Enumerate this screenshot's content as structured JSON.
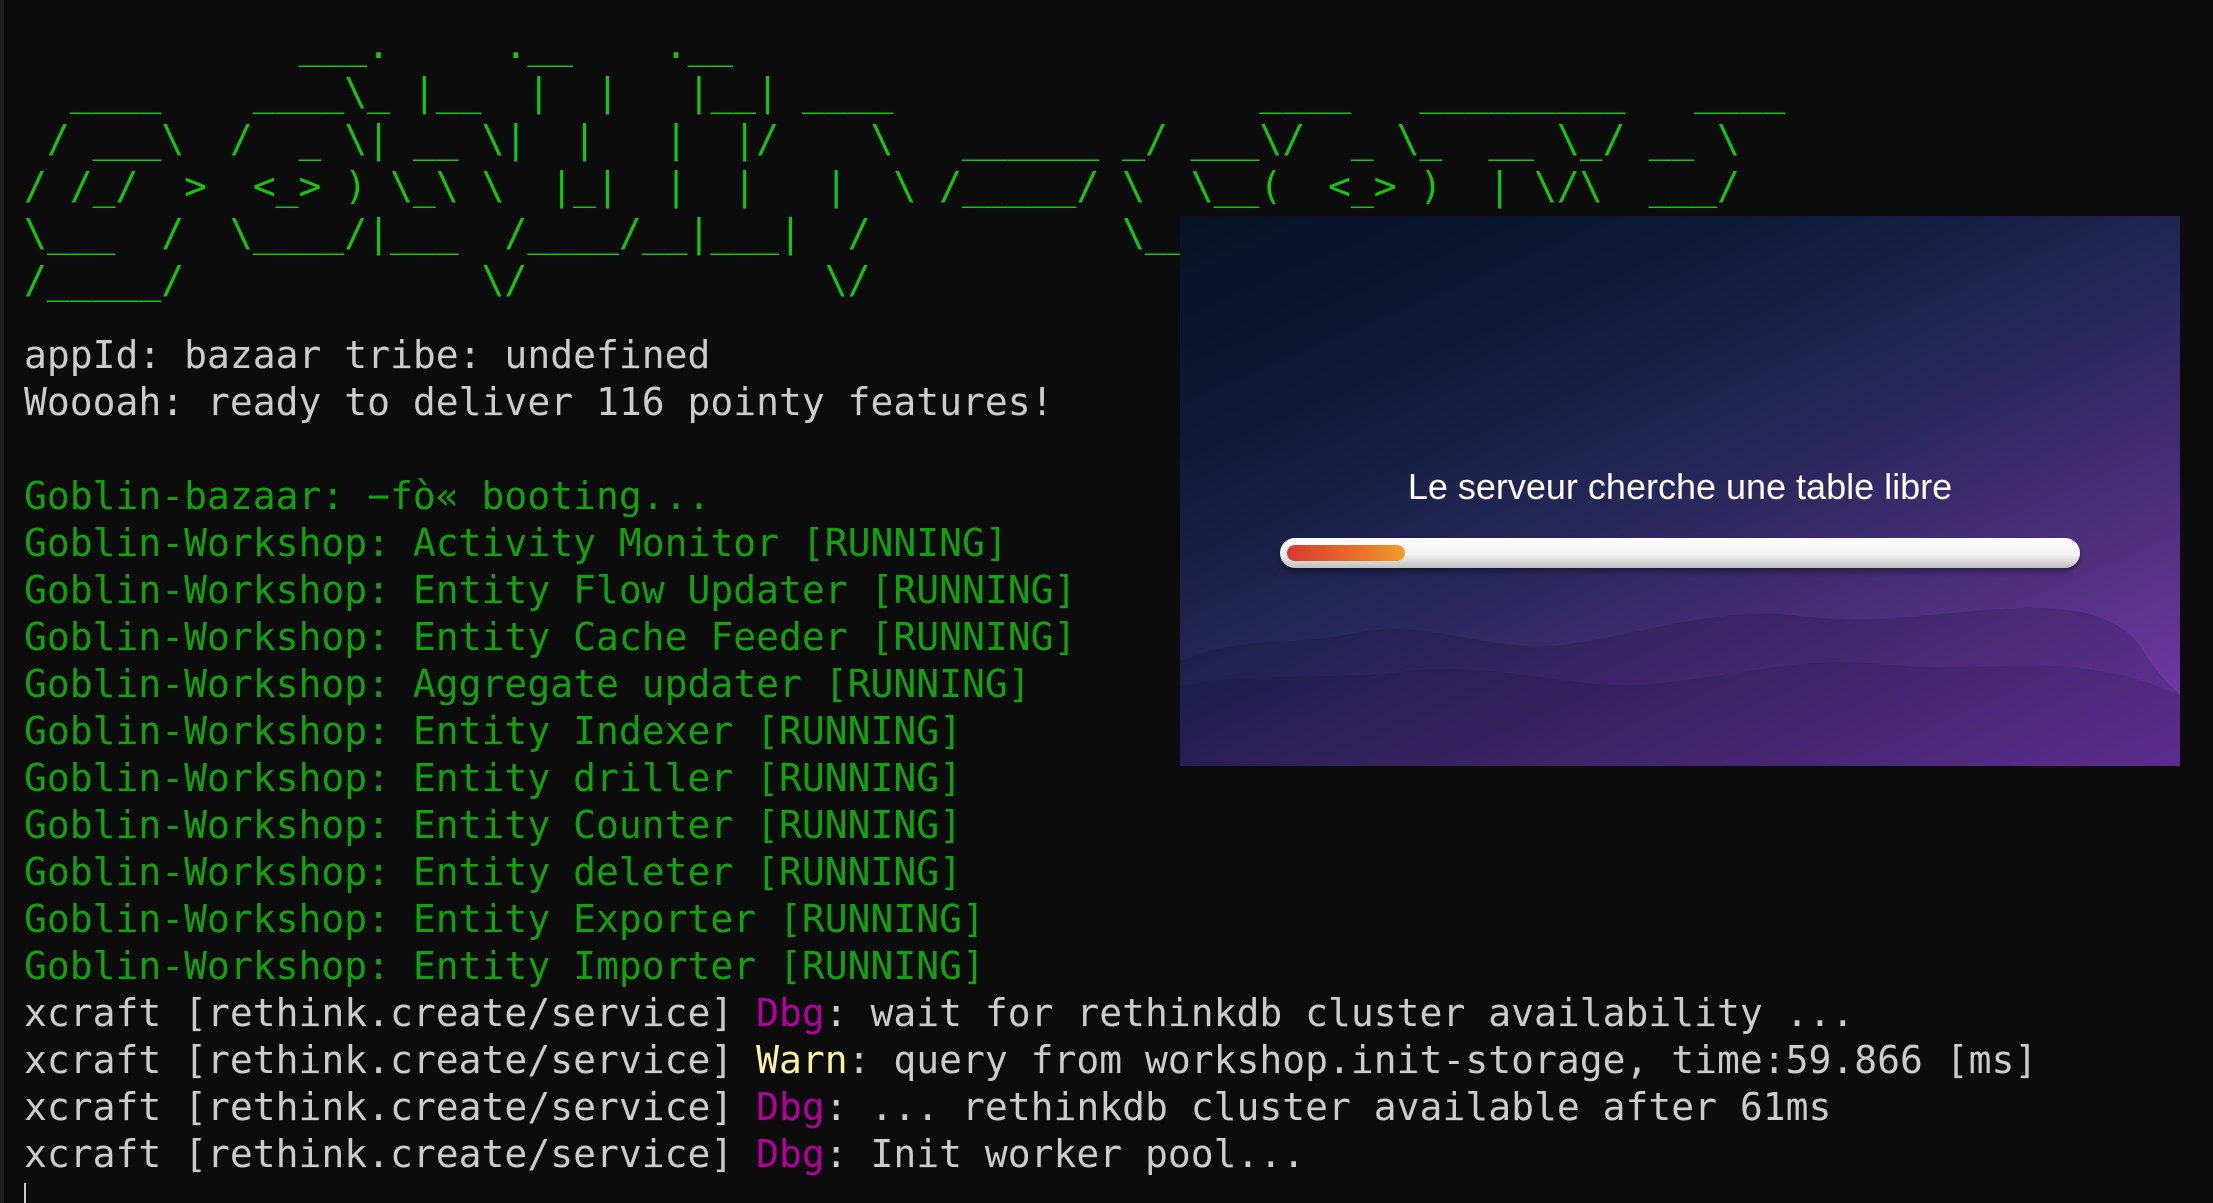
{
  "terminal": {
    "banner": [
      "            ___.     .__    .__",
      "  ____    ____\\_ |__  |  |   |__| ____                ____   _________   ____",
      " / ___\\  /  _ \\| __ \\|  |   |  |/    \\   ______ _/ ___\\/  _ \\_  __ \\_/ __ \\",
      "/ /_/  >  <_> ) \\_\\ \\  |_|  |  |   |  \\ /_____/ \\  \\__(  <_> )  | \\/\\  ___/",
      "\\___  /  \\____/|___  /____/__|___|  /           \\___  >____/|__|    \\___  >",
      "/_____/             \\/             \\/"
    ],
    "lines": [
      {
        "segments": [
          {
            "text": "appId: bazaar tribe: undefined",
            "color": "white"
          }
        ]
      },
      {
        "segments": [
          {
            "text": "Woooah: ready to deliver 116 pointy features!",
            "color": "white"
          }
        ]
      },
      {
        "segments": [
          {
            "text": "",
            "color": "white"
          }
        ]
      },
      {
        "segments": [
          {
            "text": "Goblin-bazaar: −fò« booting...",
            "color": "green"
          }
        ]
      },
      {
        "segments": [
          {
            "text": "Goblin-Workshop: Activity Monitor [RUNNING]",
            "color": "green"
          }
        ]
      },
      {
        "segments": [
          {
            "text": "Goblin-Workshop: Entity Flow Updater [RUNNING]",
            "color": "green"
          }
        ]
      },
      {
        "segments": [
          {
            "text": "Goblin-Workshop: Entity Cache Feeder [RUNNING]",
            "color": "green"
          }
        ]
      },
      {
        "segments": [
          {
            "text": "Goblin-Workshop: Aggregate updater [RUNNING]",
            "color": "green"
          }
        ]
      },
      {
        "segments": [
          {
            "text": "Goblin-Workshop: Entity Indexer [RUNNING]",
            "color": "green"
          }
        ]
      },
      {
        "segments": [
          {
            "text": "Goblin-Workshop: Entity driller [RUNNING]",
            "color": "green"
          }
        ]
      },
      {
        "segments": [
          {
            "text": "Goblin-Workshop: Entity Counter [RUNNING]",
            "color": "green"
          }
        ]
      },
      {
        "segments": [
          {
            "text": "Goblin-Workshop: Entity deleter [RUNNING]",
            "color": "green"
          }
        ]
      },
      {
        "segments": [
          {
            "text": "Goblin-Workshop: Entity Exporter [RUNNING]",
            "color": "green"
          }
        ]
      },
      {
        "segments": [
          {
            "text": "Goblin-Workshop: Entity Importer [RUNNING]",
            "color": "green"
          }
        ]
      },
      {
        "segments": [
          {
            "text": "xcraft [rethink.create/service] ",
            "color": "white"
          },
          {
            "text": "Dbg",
            "color": "dbg"
          },
          {
            "text": ": wait for rethinkdb cluster availability ...",
            "color": "white"
          }
        ]
      },
      {
        "segments": [
          {
            "text": "xcraft [rethink.create/service] ",
            "color": "white"
          },
          {
            "text": "Warn",
            "color": "warn"
          },
          {
            "text": ": query from workshop.init-storage, time:59.866 [ms]",
            "color": "white"
          }
        ]
      },
      {
        "segments": [
          {
            "text": "xcraft [rethink.create/service] ",
            "color": "white"
          },
          {
            "text": "Dbg",
            "color": "dbg"
          },
          {
            "text": ": ... rethinkdb cluster available after 61ms",
            "color": "white"
          }
        ]
      },
      {
        "segments": [
          {
            "text": "xcraft [rethink.create/service] ",
            "color": "white"
          },
          {
            "text": "Dbg",
            "color": "dbg"
          },
          {
            "text": ": Init worker pool...",
            "color": "white"
          }
        ]
      }
    ]
  },
  "overlay": {
    "message": "Le serveur cherche une table libre",
    "progress": 0.15
  },
  "colors": {
    "background": "#0c0c0c",
    "banner": "#16c60c",
    "white": "#cccccc",
    "green": "#13a10e",
    "dbg": "#b4009e",
    "warn": "#f9f1a5",
    "progress_start": "#d93a2c",
    "progress_end": "#f0a028"
  }
}
